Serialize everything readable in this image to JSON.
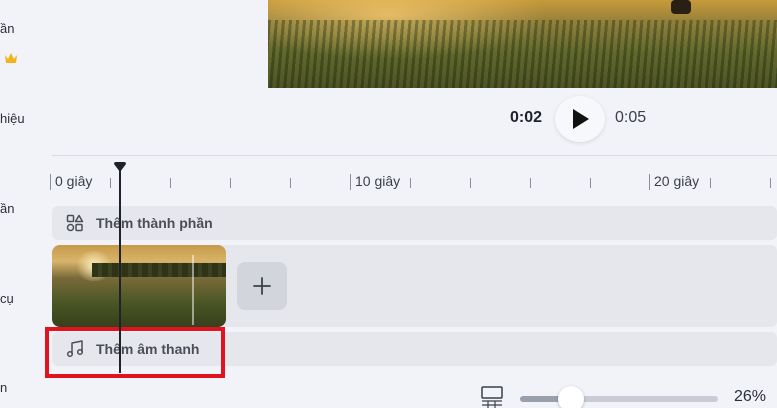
{
  "sidebar": {
    "items": [
      {
        "label": "ần"
      },
      {
        "label": "hiệu"
      },
      {
        "label": "ần"
      },
      {
        "label": "cụ"
      },
      {
        "label": "n"
      }
    ],
    "crown_icon": "crown-icon",
    "crown_color": "#f2b31b"
  },
  "player": {
    "current_time": "0:02",
    "total_time": "0:05",
    "play_icon": "play-icon"
  },
  "ruler": {
    "labels": [
      "0 giây",
      "10 giây",
      "20 giây"
    ]
  },
  "tracks": {
    "add_element_label": "Thêm thành phần",
    "add_element_icon": "shapes-icon",
    "add_clip_icon": "plus-icon",
    "add_audio_label": "Thêm âm thanh",
    "add_audio_icon": "music-note-icon"
  },
  "zoom": {
    "value_label": "26%",
    "level": 0.26,
    "view_icon": "grid-view-icon"
  },
  "colors": {
    "highlight": "#e0141e",
    "playhead": "#1f2329"
  }
}
